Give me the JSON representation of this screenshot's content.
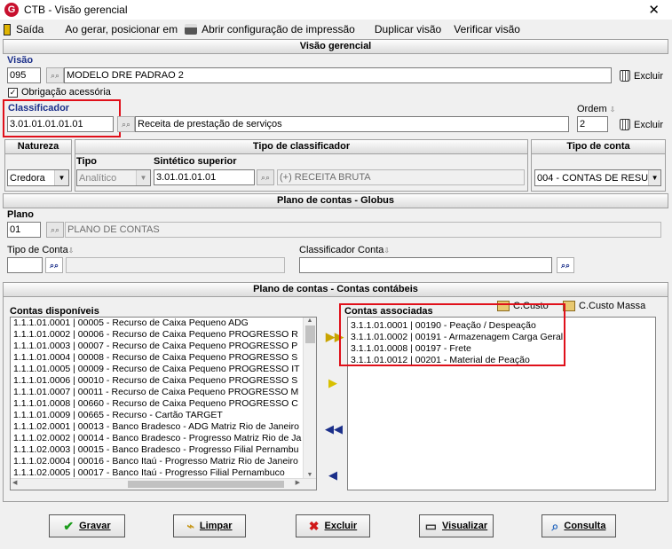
{
  "window": {
    "title": "CTB - Visão gerencial",
    "close": "✕",
    "logo": "G"
  },
  "menu": {
    "sair": "Saída",
    "posicionar": "Ao gerar, posicionar em",
    "abrir_config": "Abrir configuração de impressão",
    "duplicar": "Duplicar visão",
    "verificar": "Verificar visão"
  },
  "visao_section": {
    "header": "Visão gerencial",
    "visao_label": "Visão",
    "visao_code": "095",
    "visao_name": "MODELO DRE PADRAO 2",
    "excluir": "Excluir",
    "obrigacao": "Obrigação acessória",
    "classificador_label": "Classificador",
    "classificador_value": "3.01.01.01.01.01",
    "classificador_desc": "Receita de prestação de serviços",
    "ordem_label": "Ordem",
    "ordem_value": "2"
  },
  "natureza": {
    "header": "Natureza",
    "value": "Credora"
  },
  "tipo_classificador": {
    "header": "Tipo de classificador",
    "tipo_label": "Tipo",
    "tipo_value": "Analítico",
    "sintetico_label": "Sintético superior",
    "sintetico_value": "3.01.01.01.01",
    "sintetico_desc": "(+) RECEITA BRUTA"
  },
  "tipo_conta": {
    "header": "Tipo de conta",
    "value": "004 - CONTAS DE RESU"
  },
  "plano_section": {
    "header": "Plano de contas - Globus",
    "plano_label": "Plano",
    "plano_code": "01",
    "plano_name": "PLANO DE CONTAS",
    "tipo_conta_label": "Tipo de Conta",
    "classificador_conta_label": "Classificador Conta"
  },
  "contas_section": {
    "header": "Plano de contas - Contas contábeis",
    "disponiveis_label": "Contas disponíveis",
    "associadas_label": "Contas associadas",
    "ccusto": "C.Custo",
    "ccusto_massa": "C.Custo Massa",
    "disponiveis": [
      "1.1.1.01.0001 | 00005 - Recurso de Caixa Pequeno ADG",
      "1.1.1.01.0002 | 00006 - Recurso de Caixa Pequeno PROGRESSO R",
      "1.1.1.01.0003 | 00007 - Recurso de Caixa Pequeno PROGRESSO P",
      "1.1.1.01.0004 | 00008 - Recurso de Caixa Pequeno PROGRESSO S",
      "1.1.1.01.0005 | 00009 - Recurso de Caixa Pequeno PROGRESSO IT",
      "1.1.1.01.0006 | 00010 - Recurso de Caixa Pequeno PROGRESSO S",
      "1.1.1.01.0007 | 00011 - Recurso de Caixa Pequeno PROGRESSO M",
      "1.1.1.01.0008 | 00660 - Recurso de Caixa Pequeno PROGRESSO C",
      "1.1.1.01.0009 | 00665 - Recurso - Cartão TARGET",
      "1.1.1.02.0001 | 00013 - Banco Bradesco - ADG Matriz Rio de Janeiro",
      "1.1.1.02.0002 | 00014 - Banco Bradesco - Progresso Matriz Rio de Ja",
      "1.1.1.02.0003 | 00015 - Banco Bradesco - Progresso  Filial Pernambu",
      "1.1.1.02.0004 | 00016 - Banco Itaú - Progresso Matriz Rio de Janeiro",
      "1.1.1.02.0005 | 00017 - Banco Itaú - Progresso Filial Pernambuco"
    ],
    "associadas": [
      "3.1.1.01.0001 | 00190 - Peação / Despeação",
      "3.1.1.01.0002 | 00191 - Armazenagem Carga Geral",
      "3.1.1.01.0008 | 00197 - Frete",
      "3.1.1.01.0012 | 00201 - Material de Peação"
    ]
  },
  "buttons": {
    "gravar": "Gravar",
    "limpar": "Limpar",
    "excluir": "Excluir",
    "visualizar": "Visualizar",
    "consulta": "Consulta"
  }
}
